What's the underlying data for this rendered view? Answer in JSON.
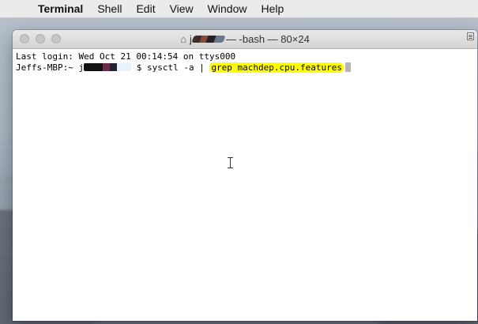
{
  "menubar": {
    "apple_icon": "",
    "app_name": "Terminal",
    "items": [
      "Shell",
      "Edit",
      "View",
      "Window",
      "Help"
    ]
  },
  "window": {
    "title_home_icon": "⌂",
    "title_user_initial": "j",
    "title_text": "— -bash — 80×24"
  },
  "terminal": {
    "line1": "Last login: Wed Oct 21 00:14:54 on ttys000",
    "prompt_prefix": "Jeffs-MBP:~ j",
    "command_start": "$ sysctl -a | ",
    "command_highlight": "grep machdep.cpu.features"
  },
  "colors": {
    "highlight": "#ffff00",
    "window_bg": "#ffffff"
  }
}
